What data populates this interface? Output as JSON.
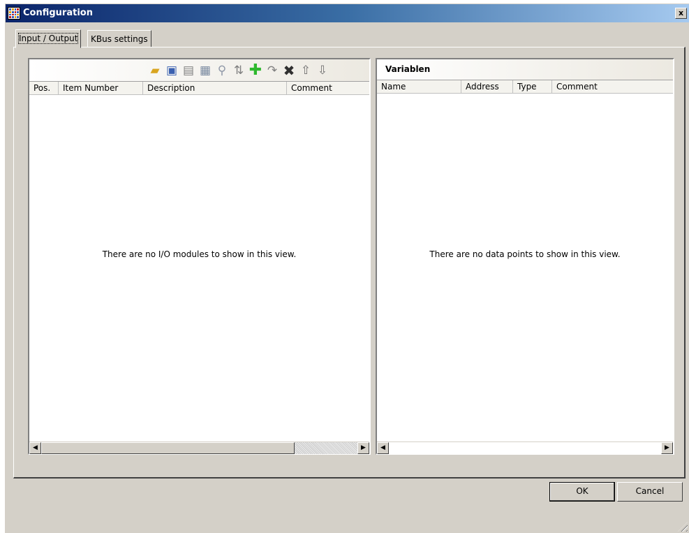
{
  "window": {
    "title": "Configuration",
    "close_label": "x"
  },
  "tabs": [
    {
      "label": "Input / Output",
      "active": true
    },
    {
      "label": "KBus settings",
      "active": false
    }
  ],
  "io_panel": {
    "toolbar_icons": [
      "open-folder-icon",
      "save-icon",
      "document-icon",
      "properties-icon",
      "search-icon",
      "swap-icon",
      "add-icon",
      "redo-icon",
      "delete-icon",
      "arrow-up-icon",
      "arrow-down-icon"
    ],
    "columns": [
      "Pos.",
      "Item Number",
      "Description",
      "Comment"
    ],
    "empty_message": "There are no I/O modules to show in this view."
  },
  "variables_panel": {
    "title": "Variablen",
    "columns": [
      "Name",
      "Address",
      "Type",
      "Comment"
    ],
    "empty_message": "There are no data points to show in this view."
  },
  "buttons": {
    "ok": "OK",
    "cancel": "Cancel"
  },
  "colors": {
    "titlebar_start": "#0a246a",
    "titlebar_end": "#a6caf0",
    "dialog_bg": "#d4d0c8",
    "add_icon": "#2eb82e"
  }
}
